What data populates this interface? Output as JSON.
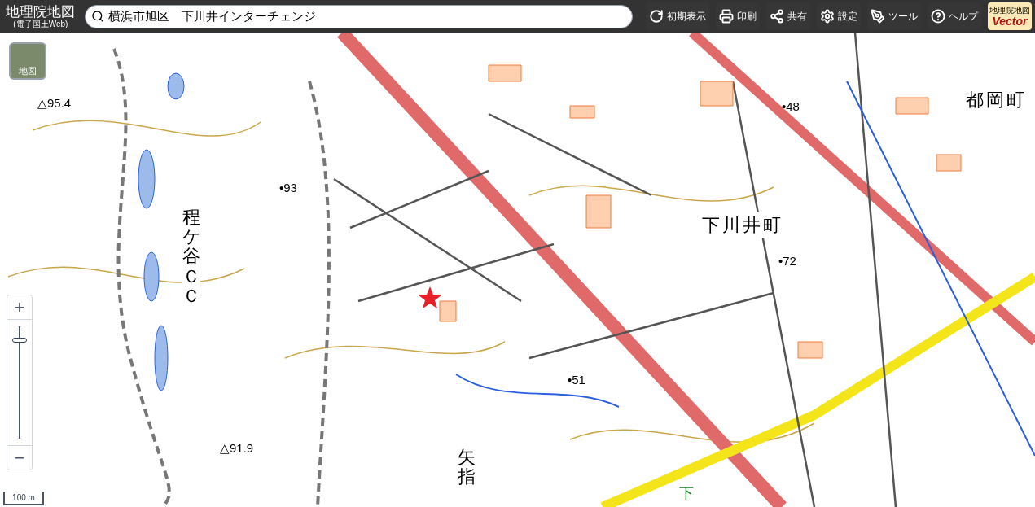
{
  "header": {
    "logo": "地理院地図",
    "logo_sub": "(電子国土Web)",
    "search": {
      "value": "横浜市旭区　下川井インターチェンジ"
    },
    "tools": [
      {
        "kind": "reset",
        "label": "初期表示"
      },
      {
        "kind": "print",
        "label": "印刷"
      },
      {
        "kind": "share",
        "label": "共有"
      },
      {
        "kind": "settings",
        "label": "設定"
      },
      {
        "kind": "tool",
        "label": "ツール"
      },
      {
        "kind": "help",
        "label": "ヘルプ"
      }
    ],
    "vector_badge": {
      "title": "地理院地図",
      "label": "Vector"
    }
  },
  "basemap_button": {
    "label": "地図"
  },
  "zoom": {
    "plus": "+",
    "minus": "−",
    "level": 0.88
  },
  "scale": "100 m",
  "map_labels": [
    {
      "kind": "elev",
      "text": "△95.4"
    },
    {
      "kind": "point",
      "text": "•93"
    },
    {
      "kind": "vertical",
      "text": "程ケ谷ＣＣ"
    },
    {
      "kind": "point",
      "text": "•48"
    },
    {
      "kind": "place",
      "text": "都岡町"
    },
    {
      "kind": "place",
      "text": "下川井町"
    },
    {
      "kind": "point",
      "text": "•72"
    },
    {
      "kind": "point",
      "text": "•51"
    },
    {
      "kind": "elev",
      "text": "△91.9"
    },
    {
      "kind": "vertical",
      "text": "矢指"
    },
    {
      "kind": "green",
      "text": "下"
    }
  ]
}
